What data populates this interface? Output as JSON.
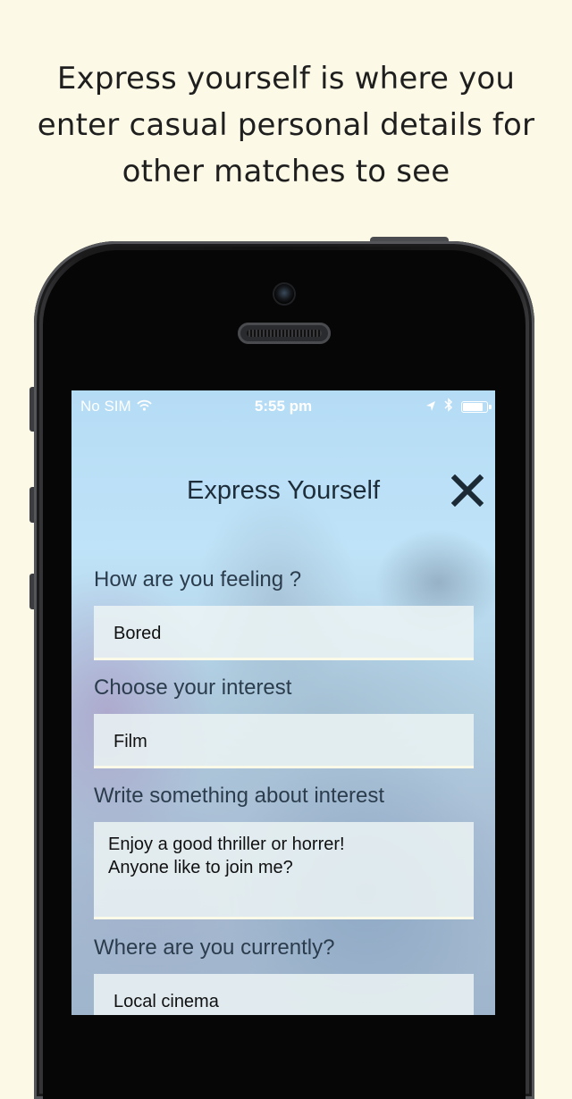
{
  "caption": {
    "line1": "Express yourself is where you",
    "line2": "enter casual personal details for",
    "line3": "other matches to see"
  },
  "status_bar": {
    "carrier": "No SIM",
    "time": "5:55 pm",
    "battery_level": 0.9
  },
  "screen": {
    "title": "Express Yourself",
    "fields": {
      "feeling": {
        "label": "How are you feeling ?",
        "value": "Bored"
      },
      "interest": {
        "label": "Choose your interest",
        "value": "Film"
      },
      "about": {
        "label": "Write something about interest",
        "value": "Enjoy a good thriller or horrer!\nAnyone like to join me?"
      },
      "location": {
        "label": "Where are you currently?",
        "value": "Local cinema"
      }
    }
  },
  "icons": {
    "close": "close-icon",
    "wifi": "wifi-icon",
    "location": "location-arrow-icon",
    "bluetooth": "bluetooth-icon",
    "battery": "battery-icon"
  },
  "colors": {
    "background": "#fcfae6",
    "title_text": "#1e2d3a",
    "field_underline": "#fbfae8"
  }
}
